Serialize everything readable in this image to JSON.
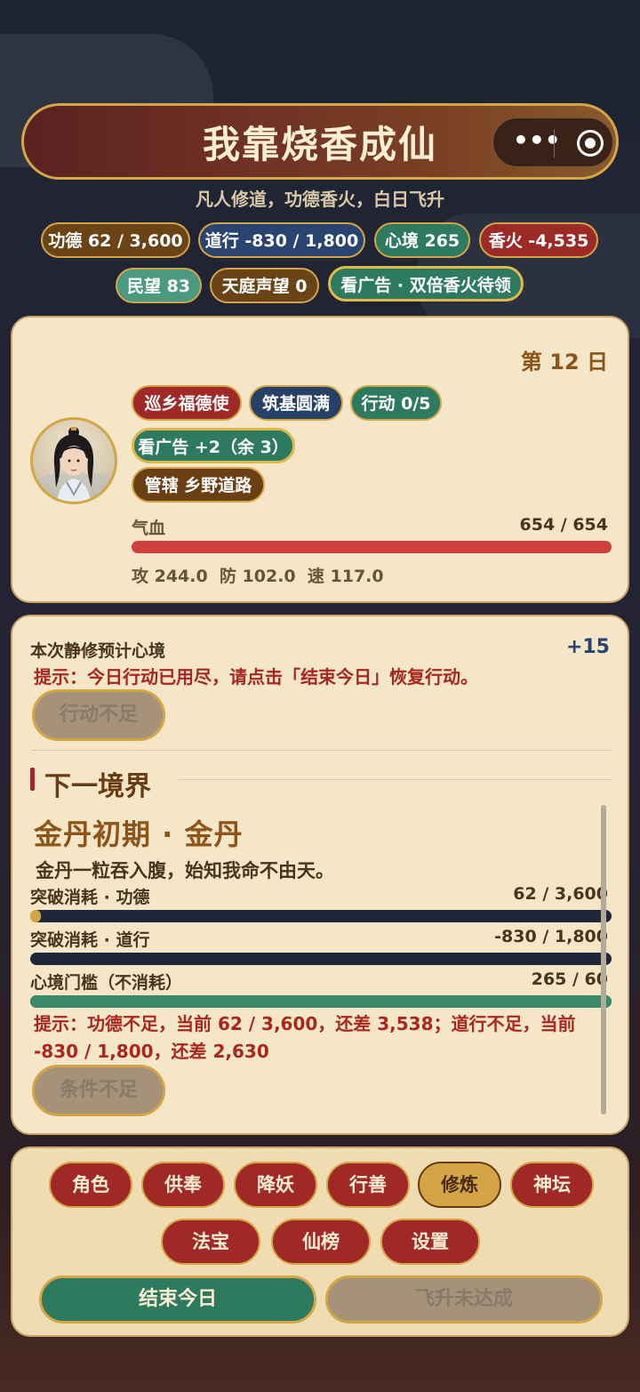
{
  "app": {
    "title": "我靠烧香成仙",
    "subtitle": "凡人修道，功德香火，白日飞升",
    "capsule_more": "•••"
  },
  "stats": {
    "merit": "功德 62 / 3,600",
    "dao": "道行 -830 / 1,800",
    "mind": "心境 265",
    "incense": "香火 -4,535",
    "folk": "民望 83",
    "heaven": "天庭声望 0",
    "ad": "看广告 · 双倍香火待领"
  },
  "character": {
    "day": "第 12 日",
    "title_tag": "巡乡福德使",
    "realm_tag": "筑基圆满",
    "action_tag": "行动 0/5",
    "ad_tag": "看广告 +2（余 3）",
    "domain_tag": "管辖 乡野道路",
    "hp_label": "气血",
    "hp_value": "654 / 654",
    "hp_fraction": 1.0,
    "attrs": "攻 244.0  防 102.0  速 117.0"
  },
  "cultivate": {
    "preview_label": "本次静修预计心境",
    "preview_value": "+15",
    "hint": "提示：今日行动已用尽，请点击「结束今日」恢复行动。",
    "button": "行动不足"
  },
  "next_realm": {
    "section_title": "下一境界",
    "realm_name": "金丹初期 · 金丹",
    "quote": "金丹一粒吞入腹，始知我命不由天。",
    "merit_label": "突破消耗 · 功德",
    "merit_value": "62 / 3,600",
    "merit_fraction": 0.017,
    "dao_label": "突破消耗 · 道行",
    "dao_value": "-830 / 1,800",
    "dao_fraction": 0.0,
    "mind_label": "心境门槛（不消耗）",
    "mind_value": "265 / 60",
    "mind_fraction": 1.0,
    "hint": "提示：功德不足，当前 62 / 3,600，还差 3,538；道行不足，当前 -830 / 1,800，还差 2,630",
    "button": "条件不足"
  },
  "nav": {
    "items": [
      "角色",
      "供奉",
      "降妖",
      "行善",
      "修炼",
      "神坛",
      "法宝",
      "仙榜",
      "设置"
    ],
    "active": "修炼",
    "end_day": "结束今日",
    "ascend": "飞升未达成"
  },
  "colors": {
    "accent_gold": "#d4a545",
    "red": "#a02826",
    "green": "#2e7a5e",
    "navy": "#1e2838"
  }
}
